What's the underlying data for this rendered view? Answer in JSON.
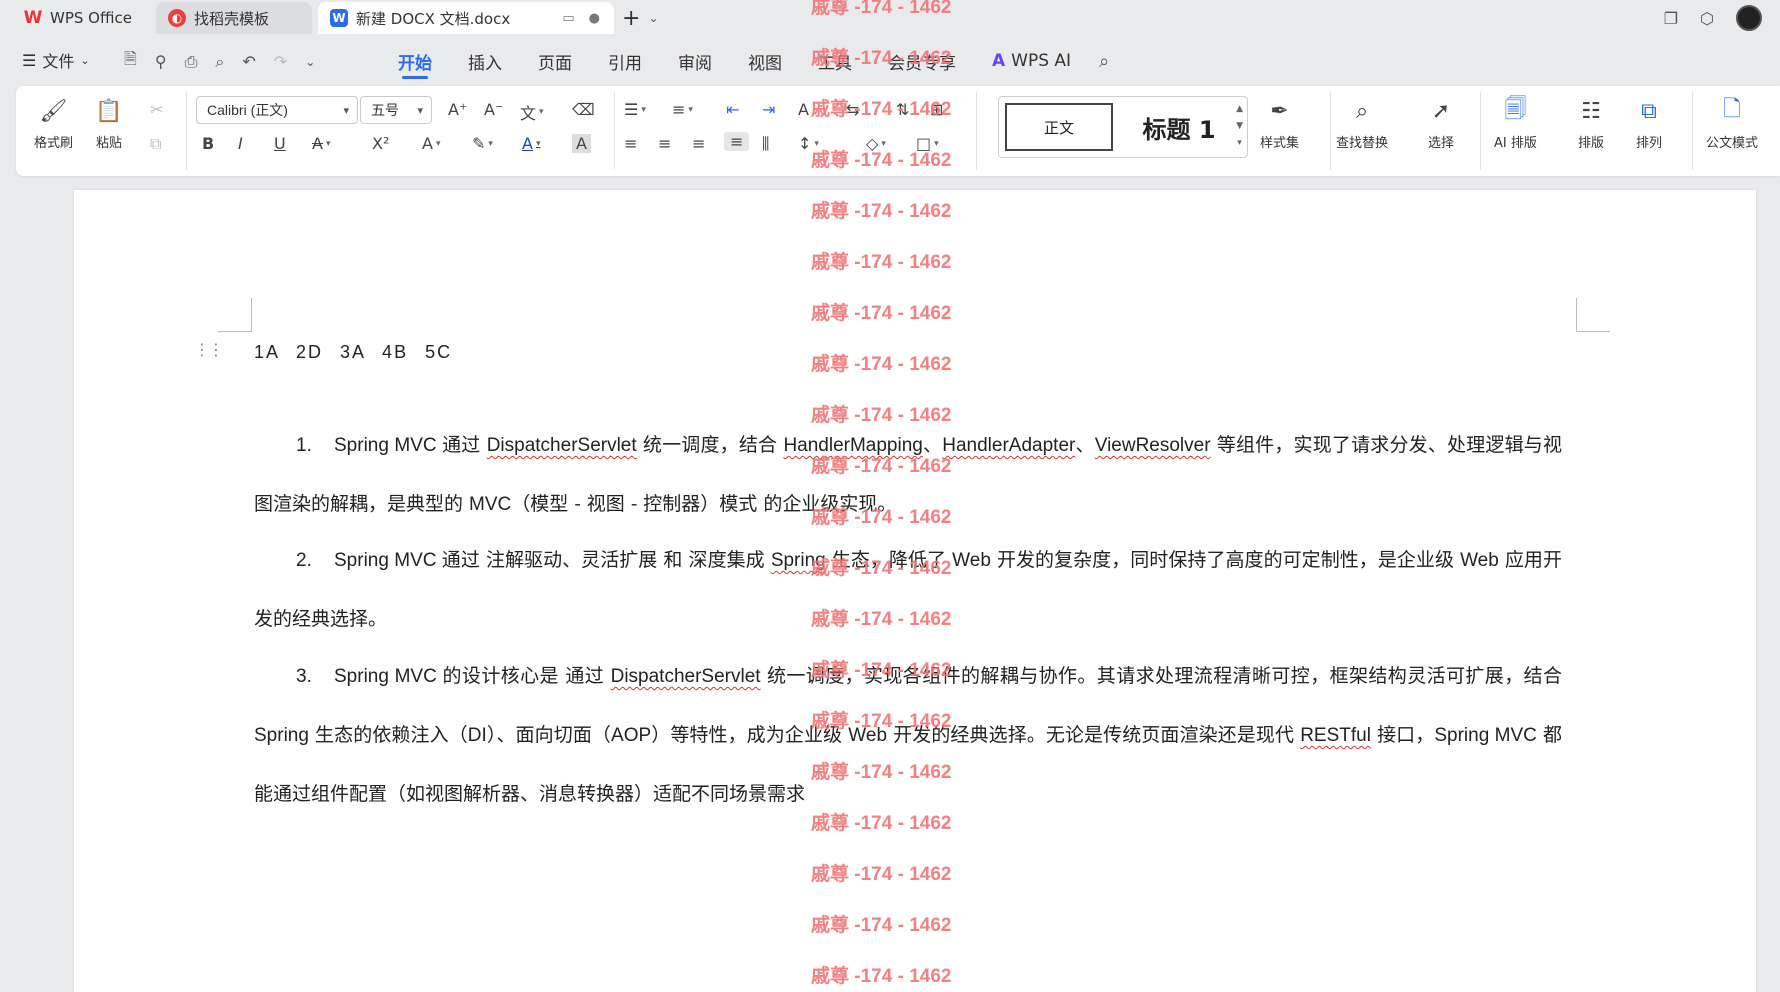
{
  "tabs": {
    "home": "WPS Office",
    "template": "找稻壳模板",
    "document": "新建 DOCX 文档.docx"
  },
  "menu": {
    "file": "文件",
    "tabs": [
      "开始",
      "插入",
      "页面",
      "引用",
      "审阅",
      "视图",
      "工具",
      "会员专享"
    ],
    "ai": "WPS AI"
  },
  "ribbon": {
    "format_painter": "格式刷",
    "paste": "粘贴",
    "font_family": "Calibri (正文)",
    "font_size": "五号",
    "bold": "B",
    "italic": "I",
    "underline": "U",
    "superscript": "X²",
    "style_normal": "正文",
    "style_heading": "标题 1",
    "style_set": "样式集",
    "find_replace": "查找替换",
    "select": "选择",
    "ai_layout": "AI 排版",
    "layout": "排版",
    "arrange": "排列",
    "official_mode": "公文模式"
  },
  "document": {
    "answers": "1A   2D   3A   4B   5C",
    "paragraphs": [
      {
        "num": "1.",
        "parts": [
          {
            "t": "Spring MVC ",
            "en": true
          },
          {
            "t": "通过 "
          },
          {
            "t": "DispatcherServlet",
            "en": true,
            "wavy": true
          },
          {
            "t": " 统一调度，结合 "
          },
          {
            "t": "HandlerMapping",
            "en": true,
            "wavy": true
          },
          {
            "t": "、"
          },
          {
            "t": "HandlerAdapter",
            "en": true,
            "wavy": true
          },
          {
            "t": "、"
          },
          {
            "t": "ViewResolver",
            "en": true,
            "wavy": true
          },
          {
            "t": " 等组件，实现了请求分发、处理逻辑与视图渲染的解耦，是典型的 "
          },
          {
            "t": "MVC",
            "en": true
          },
          {
            "t": "（模型 - 视图 - 控制器）模式 的企业级实现。"
          }
        ]
      },
      {
        "num": "2.",
        "parts": [
          {
            "t": "Spring MVC ",
            "en": true
          },
          {
            "t": "通过 注解驱动、灵活扩展 和 深度集成 "
          },
          {
            "t": "Spring",
            "en": true,
            "wavy": true
          },
          {
            "t": " 生态，降低了 "
          },
          {
            "t": "Web",
            "en": true
          },
          {
            "t": " 开发的复杂度，同时保持了高度的可定制性，是企业级 "
          },
          {
            "t": "Web",
            "en": true
          },
          {
            "t": " 应用开发的经典选择。"
          }
        ]
      },
      {
        "num": "3.",
        "parts": [
          {
            "t": "Spring MVC ",
            "en": true
          },
          {
            "t": "的设计核心是 通过 "
          },
          {
            "t": "DispatcherServlet",
            "en": true,
            "wavy": true
          },
          {
            "t": " 统一调度，实现各组件的解耦与协作。其请求处理流程清晰可控，框架结构灵活可扩展，结合 "
          },
          {
            "t": "Spring",
            "en": true
          },
          {
            "t": " 生态的依赖注入（"
          },
          {
            "t": "DI",
            "en": true
          },
          {
            "t": "）、面向切面（"
          },
          {
            "t": "AOP",
            "en": true
          },
          {
            "t": "）等特性，成为企业级 "
          },
          {
            "t": "Web",
            "en": true
          },
          {
            "t": " 开发的经典选择。无论是传统页面渲染还是现代 "
          },
          {
            "t": "RESTful",
            "en": true,
            "wavy": true
          },
          {
            "t": " 接口，"
          },
          {
            "t": "Spring MVC",
            "en": true
          },
          {
            "t": " 都能通过组件配置（如视图解析器、消息转换器）适配不同场景需求"
          }
        ]
      }
    ]
  },
  "watermark": "戚尊 -174 - 1462",
  "colors": {
    "accent": "#2a6bf0",
    "watermark": "#f27474",
    "spellcheck": "#d33"
  }
}
